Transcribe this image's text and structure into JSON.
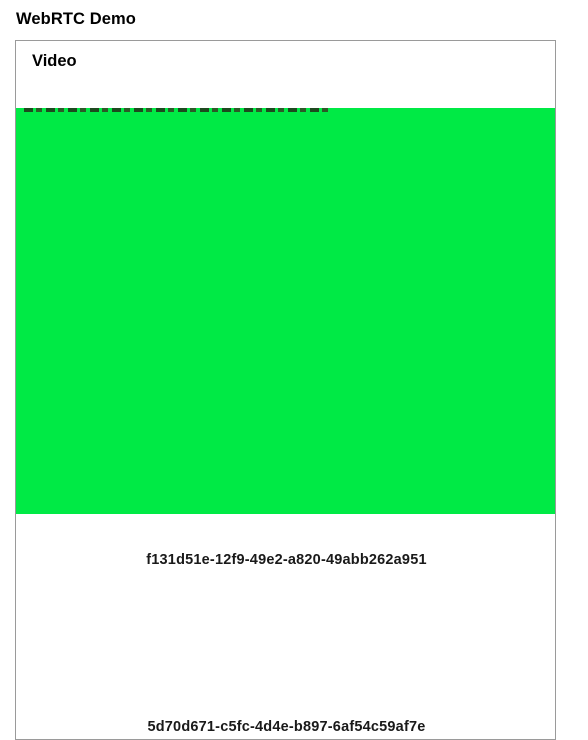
{
  "page": {
    "title": "WebRTC Demo"
  },
  "video_panel": {
    "title": "Video",
    "video_color": "#00ea45",
    "stream_ids": [
      "f131d51e-12f9-49e2-a820-49abb262a951",
      "5d70d671-c5fc-4d4e-b897-6af54c59af7e"
    ]
  }
}
